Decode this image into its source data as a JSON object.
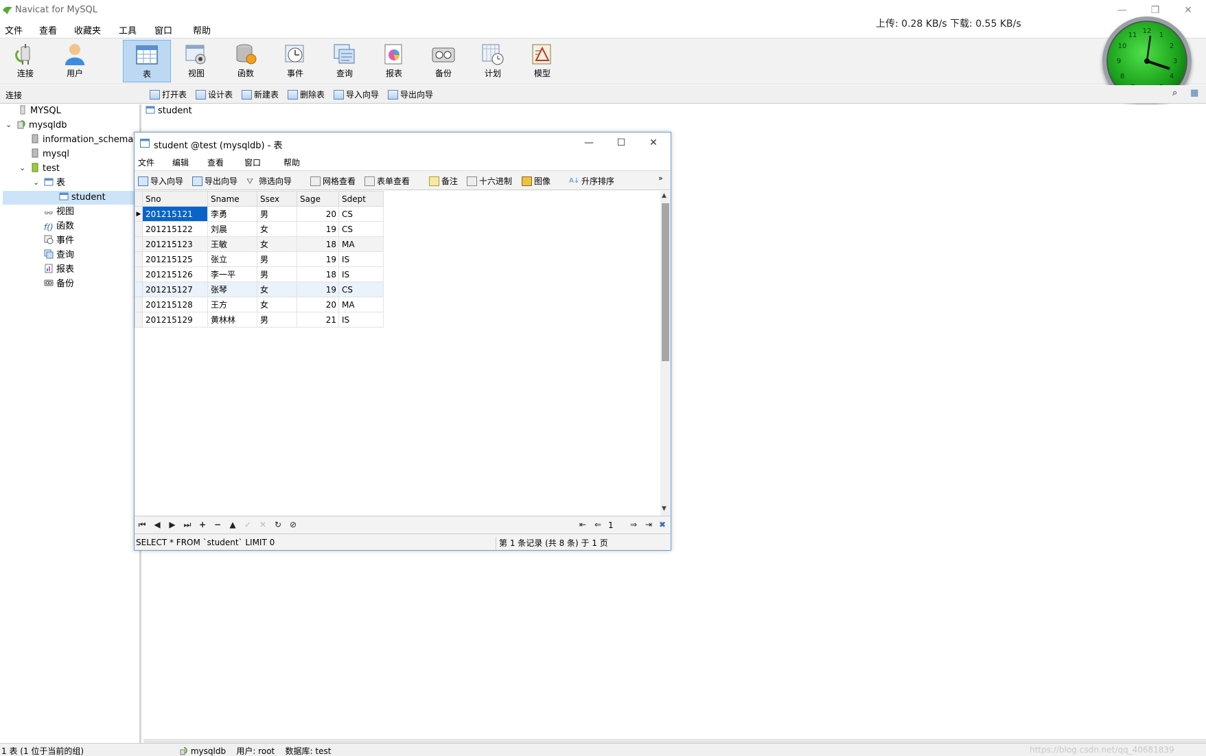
{
  "window": {
    "title": "Navicat for MySQL",
    "controls": [
      "minimize",
      "restore",
      "close"
    ]
  },
  "menu": [
    "文件",
    "查看",
    "收藏夹",
    "工具",
    "窗口",
    "帮助"
  ],
  "network_speed": "上传: 0.28 KB/s   下载: 0.55 KB/s",
  "toolbar": [
    {
      "label": "连接",
      "icon": "connection-icon"
    },
    {
      "label": "用户",
      "icon": "user-icon"
    },
    {
      "label": "表",
      "icon": "table-icon",
      "active": true
    },
    {
      "label": "视图",
      "icon": "view-icon"
    },
    {
      "label": "函数",
      "icon": "function-icon"
    },
    {
      "label": "事件",
      "icon": "event-icon"
    },
    {
      "label": "查询",
      "icon": "query-icon"
    },
    {
      "label": "报表",
      "icon": "report-icon"
    },
    {
      "label": "备份",
      "icon": "backup-icon"
    },
    {
      "label": "计划",
      "icon": "schedule-icon"
    },
    {
      "label": "模型",
      "icon": "model-icon"
    }
  ],
  "subtoolbar": {
    "connection_label": "连接",
    "buttons": [
      "打开表",
      "设计表",
      "新建表",
      "删除表",
      "导入向导",
      "导出向导"
    ]
  },
  "tree": {
    "connection": "MYSQL",
    "database": "mysqldb",
    "schemas": [
      "information_schema",
      "mysql",
      "test"
    ],
    "tables_folder": "表",
    "table": "student",
    "folders": [
      "视图",
      "函数",
      "事件",
      "查询",
      "报表",
      "备份"
    ]
  },
  "object_tab": "student",
  "child_window": {
    "title": "student @test (mysqldb) - 表",
    "menu": [
      "文件",
      "编辑",
      "查看",
      "窗口",
      "帮助"
    ],
    "tools": [
      "导入向导",
      "导出向导",
      "筛选向导",
      "网格查看",
      "表单查看",
      "备注",
      "十六进制",
      "图像",
      "升序排序"
    ],
    "columns": [
      "Sno",
      "Sname",
      "Ssex",
      "Sage",
      "Sdept"
    ],
    "rows": [
      [
        "201215121",
        "李勇",
        "男",
        "20",
        "CS"
      ],
      [
        "201215122",
        "刘晨",
        "女",
        "19",
        "CS"
      ],
      [
        "201215123",
        "王敏",
        "女",
        "18",
        "MA"
      ],
      [
        "201215125",
        "张立",
        "男",
        "19",
        "IS"
      ],
      [
        "201215126",
        "李一平",
        "男",
        "18",
        "IS"
      ],
      [
        "201215127",
        "张琴",
        "女",
        "19",
        "CS"
      ],
      [
        "201215128",
        "王方",
        "女",
        "20",
        "MA"
      ],
      [
        "201215129",
        "黄林林",
        "男",
        "21",
        "IS"
      ]
    ],
    "page_number": "1",
    "sql": "SELECT * FROM `student` LIMIT 0",
    "record_info": "第 1 条记录 (共 8 条) 于 1 页"
  },
  "status": {
    "left": "1 表 (1 位于当前的组)",
    "connection": "mysqldb",
    "user": "用户: root",
    "database": "数据库: test",
    "watermark": "https://blog.csdn.net/qq_40681839"
  },
  "colors": {
    "selection": "#0a64c8",
    "toolbar_active": "#bcd8f3",
    "clock": "#1aa01a"
  }
}
